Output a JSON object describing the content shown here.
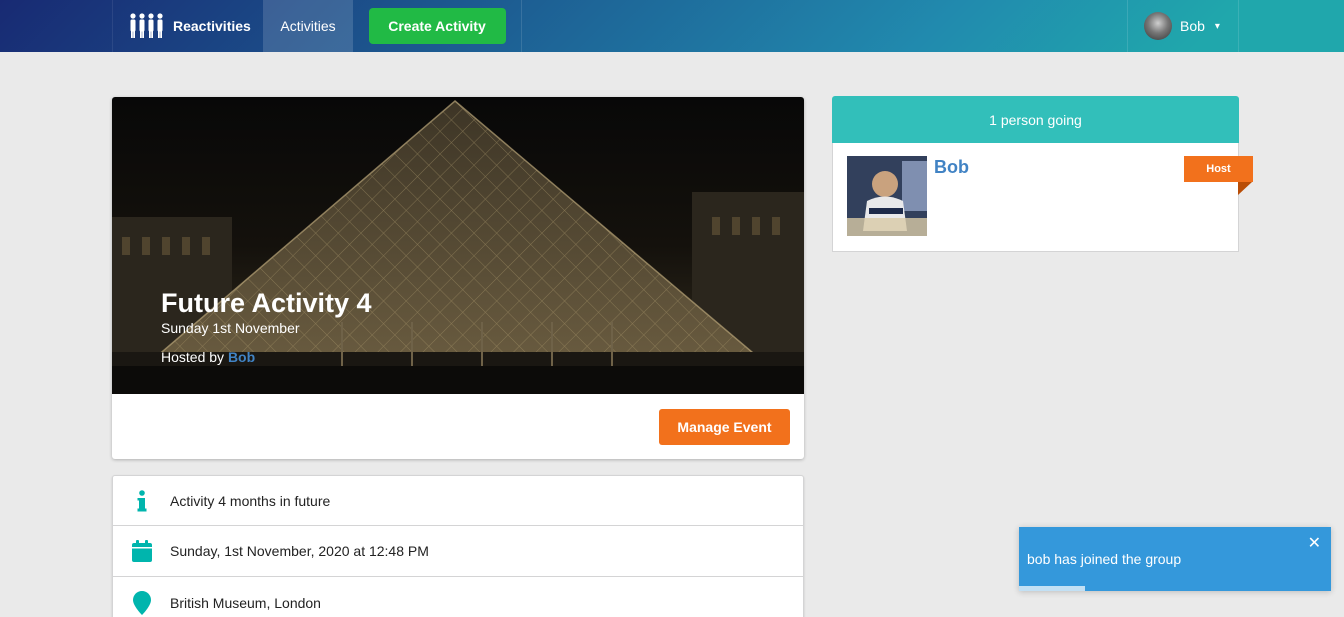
{
  "nav": {
    "brand_label": "Reactivities",
    "brand_icon": "users-icon",
    "activities_label": "Activities",
    "create_label": "Create Activity",
    "user_name": "Bob",
    "user_caret": "▾"
  },
  "activity": {
    "title": "Future Activity 4",
    "date_short": "Sunday 1st November",
    "hosted_by_prefix": "Hosted by ",
    "host_name": "Bob",
    "manage_label": "Manage Event"
  },
  "info": {
    "description": "Activity 4 months in future",
    "datetime": "Sunday, 1st November, 2020 at 12:48 PM",
    "venue": "British Museum, London"
  },
  "attendees": {
    "header": "1 person going",
    "list": [
      {
        "name": "Bob",
        "badge": "Host"
      }
    ]
  },
  "toast": {
    "message": "bob has joined the group",
    "close_glyph": "✕",
    "progress": 0.21
  },
  "colors": {
    "accent_teal": "#32bfba",
    "create_green": "#21ba45",
    "orange": "#f2711c",
    "link_blue": "#4183c4",
    "toast_blue": "#3498db"
  }
}
